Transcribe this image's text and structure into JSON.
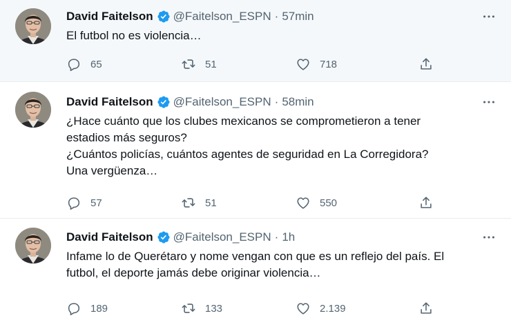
{
  "colors": {
    "text": "#0f1419",
    "secondary": "#536471",
    "verified": "#1d9bf0",
    "border": "#e6ecf0",
    "highlight_bg": "#f5f8fa"
  },
  "tweets": [
    {
      "name": "David Faitelson",
      "handle": "@Faitelson_ESPN",
      "separator": "·",
      "time": "57min",
      "lines": [
        "El futbol no es violencia…"
      ],
      "replies": "65",
      "retweets": "51",
      "likes": "718"
    },
    {
      "name": "David Faitelson",
      "handle": "@Faitelson_ESPN",
      "separator": "·",
      "time": "58min",
      "lines": [
        "¿Hace cuánto que los clubes mexicanos se comprometieron a tener",
        "estadios más seguros?",
        "¿Cuántos policías, cuántos agentes de seguridad en La Corregidora?",
        "Una vergüenza…"
      ],
      "replies": "57",
      "retweets": "51",
      "likes": "550"
    },
    {
      "name": "David Faitelson",
      "handle": "@Faitelson_ESPN",
      "separator": "·",
      "time": "1h",
      "lines": [
        "Infame lo de Querétaro y nome vengan con que es un reflejo del país. El",
        "futbol, el deporte jamás debe originar violencia…"
      ],
      "replies": "189",
      "retweets": "133",
      "likes": "2.139"
    }
  ],
  "icons": {
    "verified": "verified-badge-icon",
    "more": "more-dots-icon",
    "reply": "reply-bubble-icon",
    "retweet": "retweet-icon",
    "like": "heart-icon",
    "share": "share-icon"
  }
}
